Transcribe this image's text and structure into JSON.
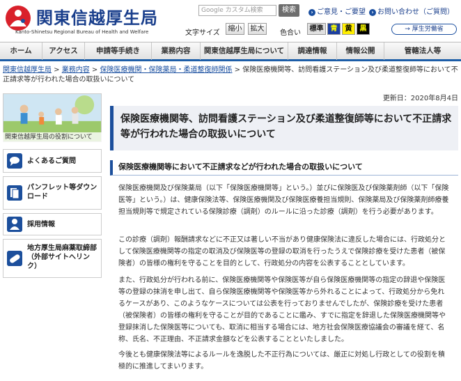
{
  "header": {
    "title": "関東信越厚生局",
    "subtitle": "Kanto-Shinetsu Regional Bureau of Health and Welfare",
    "search_placeholder": "Google カスタム検索",
    "search_button": "検索",
    "top_links": [
      "ご意見・ご要望",
      "お問い合わせ（ご質問）"
    ],
    "text_size_label": "文字サイズ",
    "text_size_buttons": [
      "縮小",
      "拡大"
    ],
    "color_label": "色合い",
    "color_buttons": [
      {
        "label": "標準",
        "bg": "#e0e0e0",
        "fg": "#222222"
      },
      {
        "label": "青",
        "bg": "#1c3fa0",
        "fg": "#ffff00"
      },
      {
        "label": "黄",
        "bg": "#ffee00",
        "fg": "#000000"
      },
      {
        "label": "黒",
        "bg": "#000000",
        "fg": "#ffff00"
      }
    ],
    "ministry_link": "厚生労働省"
  },
  "nav": {
    "items": [
      "ホーム",
      "アクセス",
      "申請等手続き",
      "業務内容",
      "関東信越厚生局について",
      "調達情報",
      "情報公開",
      "管轄法人等"
    ],
    "active": 3
  },
  "breadcrumb": {
    "links": [
      "関東信越厚生局",
      "業務内容",
      "保険医療機関・保険薬局・柔道整復師関係"
    ],
    "sep": " > ",
    "current": "保険医療機関等、訪問看護ステーション及び柔道整復師等において不正請求等が行われた場合の取扱いについて"
  },
  "sidebar": {
    "banner_caption": "関東信越厚生局の役割について",
    "items": [
      {
        "label": "よくあるご質問",
        "icon": "chat-bubble-icon"
      },
      {
        "label": "パンフレット等ダウンロード",
        "icon": "pamphlet-icon"
      },
      {
        "label": "採用情報",
        "icon": "person-icon"
      },
      {
        "label": "地方厚生局麻薬取締部（外部サイトへリンク）",
        "icon": "capsule-icon"
      }
    ]
  },
  "main": {
    "updated": "更新日：2020年8月4日",
    "title": "保険医療機関等、訪問看護ステーション及び柔道整復師等において不正請求等が行われた場合の取扱いについて",
    "heading": "保険医療機関等において不正請求などが行われた場合の取扱いについて",
    "paragraphs": [
      "保険医療機関及び保険薬局（以下「保険医療機関等」という。）並びに保険医及び保険薬剤師（以下「保険医等」という。）は、健康保険法等、保険医療機関及び保険医療養担当規則、保険薬局及び保険薬剤師療養担当規則等で規定されている保険診療（調剤）のルールに沿った診療（調剤）を行う必要があります。",
      "この診療（調剤）報酬請求などに不正又は著しい不当があり健康保険法に違反した場合には、行政処分として保険医療機関等の指定の取消及び保険医等の登録の取消を行ったうえで保険診療を受けた患者（被保険者）の皆様の権利を守ることを目的として、行政処分の内容を公表することとしています。",
      "また、行政処分が行われる前に、保険医療機関等や保険医等が自ら保険医療機関等の指定の辞退や保険医等の登録の抹消を申し出て、自ら保険医療機関等や保険医等から外れることによって、行政処分から免れるケースがあり、このようなケースについては公表を行っておりませんでしたが、保険診療を受けた患者（被保険者）の皆様の権利を守ることが目的であることに鑑み、すでに指定を辞退した保険医療機関等や登録抹消した保険医等についても、取消に相当する場合には、地方社会保険医療協議会の審議を経て、名称、氏名、不正理由、不正請求金額などを公表することといたしました。",
      "今後とも健康保険法等によるルールを逸脱した不正行為については、厳正に対処し行政としての役割を積極的に推進してまいります。"
    ]
  }
}
